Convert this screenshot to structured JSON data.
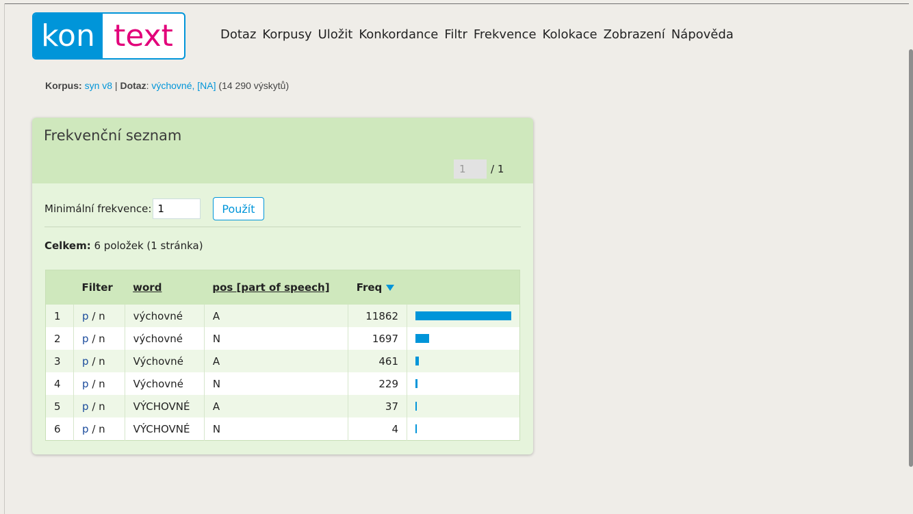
{
  "logo": {
    "left": "kon",
    "right": "text"
  },
  "menu": [
    "Dotaz",
    "Korpusy",
    "Uložit",
    "Konkordance",
    "Filtr",
    "Frekvence",
    "Kolokace",
    "Zobrazení",
    "Nápověda"
  ],
  "breadcrumb": {
    "corpus_label": "Korpus:",
    "corpus_value": "syn v8",
    "separator": "|",
    "query_label": "Dotaz",
    "query_colon": ":",
    "query_value": "výchovné, [NA]",
    "hits": "(14 290 výskytů)"
  },
  "panel": {
    "title": "Frekvenční seznam",
    "page_current": "1",
    "page_total": "/ 1",
    "minfreq_label": "Minimální frekvence:",
    "minfreq_value": "1",
    "apply_label": "Použít",
    "total_label": "Celkem:",
    "total_value": "6 položek (1 stránka)"
  },
  "table": {
    "headers": {
      "filter": "Filter",
      "word": "word",
      "pos": "pos [part of speech]",
      "freq": "Freq"
    },
    "filter_p": "p",
    "filter_sep": "/",
    "filter_n": "n",
    "rows": [
      {
        "num": "1",
        "word": "výchovné",
        "pos": "A",
        "freq": 11862
      },
      {
        "num": "2",
        "word": "výchovné",
        "pos": "N",
        "freq": 1697
      },
      {
        "num": "3",
        "word": "Výchovné",
        "pos": "A",
        "freq": 461
      },
      {
        "num": "4",
        "word": "Výchovné",
        "pos": "N",
        "freq": 229
      },
      {
        "num": "5",
        "word": "VÝCHOVNÉ",
        "pos": "A",
        "freq": 37
      },
      {
        "num": "6",
        "word": "VÝCHOVNÉ",
        "pos": "N",
        "freq": 4
      }
    ]
  },
  "colors": {
    "accent": "#0095d9",
    "brand_pink": "#e2007a",
    "panel_head": "#cfe8bd",
    "panel_body": "#e6f4dc"
  }
}
